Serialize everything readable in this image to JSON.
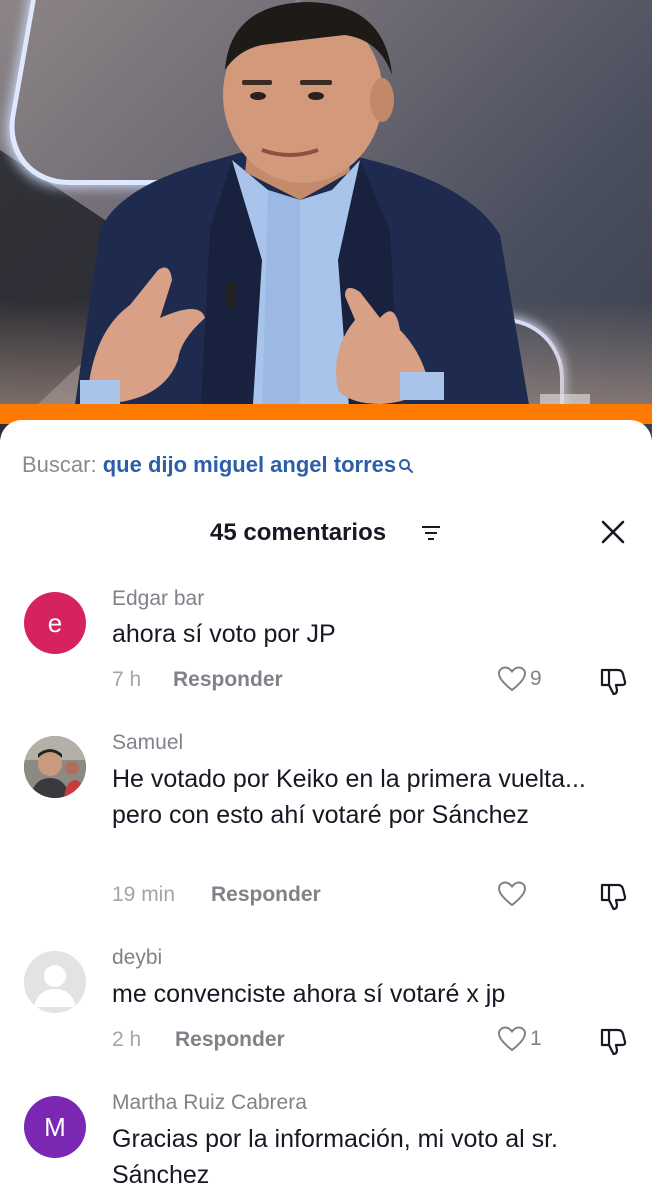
{
  "search": {
    "label": "Buscar:",
    "query": "que dijo miguel angel torres"
  },
  "header": {
    "comment_count": "45 comentarios"
  },
  "comments": [
    {
      "username": "Edgar bar",
      "avatar_letter": "e",
      "avatar_color": "#d6235f",
      "text": "ahora sí voto por JP",
      "time": "7 h",
      "reply_label": "Responder",
      "likes": "9"
    },
    {
      "username": "Samuel",
      "text": "He votado por Keiko en la primera vuelta... pero con esto ahí votaré por Sánchez",
      "time": "19 min",
      "reply_label": "Responder",
      "likes": ""
    },
    {
      "username": "deybi",
      "text": "me convenciste ahora sí votaré x jp",
      "time": "2 h",
      "reply_label": "Responder",
      "likes": "1"
    },
    {
      "username": "Martha Ruiz Cabrera",
      "avatar_letter": "M",
      "avatar_color": "#7a27b3",
      "text": "Gracias por la información, mi voto al sr. Sánchez"
    }
  ],
  "colors": {
    "accent_orange": "#ff7a00",
    "search_query": "#2b5fa8"
  }
}
